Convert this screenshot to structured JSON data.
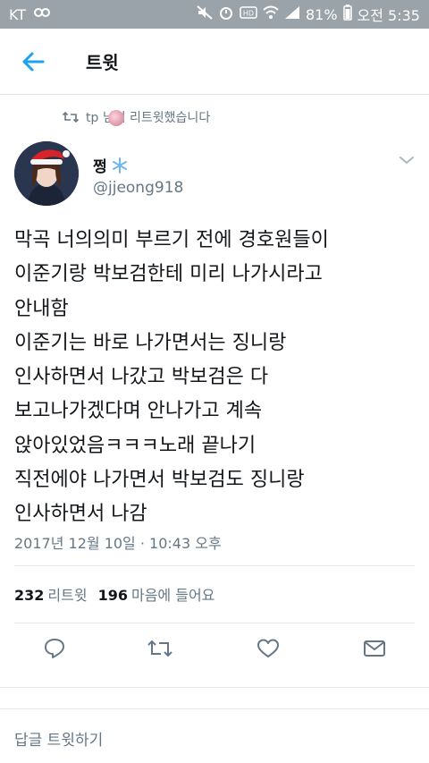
{
  "status_bar": {
    "carrier": "KT",
    "battery": "81%",
    "time": "오전 5:35"
  },
  "header": {
    "title": "트윗"
  },
  "retweet": {
    "text": "tp  님이 리트윗했습니다"
  },
  "tweet": {
    "display_name": "쩡",
    "handle": "@jjeong918",
    "text": "막곡 너의의미 부르기 전에 경호원들이\n이준기랑 박보검한테 미리 나가시라고\n안내함\n이준기는 바로 나가면서는 징니랑\n인사하면서 나갔고 박보검은 다\n보고나가겠다며 안나가고 계속\n앉아있었음ㅋㅋㅋ노래 끝나기\n직전에야 나가면서 박보검도 징니랑\n인사하면서 나감",
    "timestamp": "2017년 12월 10일 · 10:43 오후"
  },
  "stats": {
    "retweets_count": "232",
    "retweets_label": "리트윗",
    "likes_count": "196",
    "likes_label": "마음에 들어요"
  },
  "reply": {
    "placeholder": "답글 트윗하기"
  },
  "colors": {
    "accent": "#1da1f2",
    "muted": "#657786",
    "text": "#14171a",
    "statusbar": "#9aa3aa"
  }
}
